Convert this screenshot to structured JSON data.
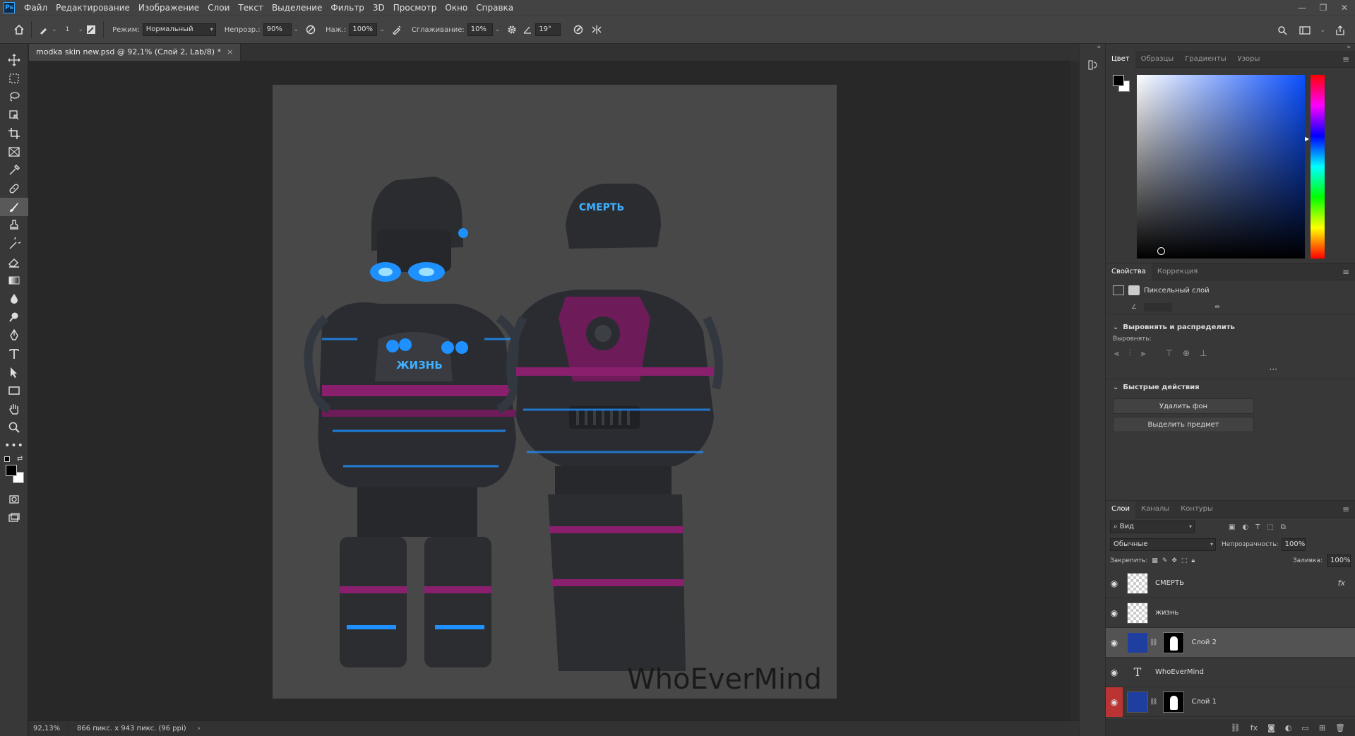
{
  "menubar": {
    "logo": "Ps",
    "items": [
      "Файл",
      "Редактирование",
      "Изображение",
      "Слои",
      "Текст",
      "Выделение",
      "Фильтр",
      "3D",
      "Просмотр",
      "Окно",
      "Справка"
    ]
  },
  "options": {
    "brush_size": "1",
    "mode_label": "Режим:",
    "mode_value": "Нормальный",
    "opacity_label": "Непрозр.:",
    "opacity_value": "90%",
    "pressure_label": "Наж.:",
    "pressure_value": "100%",
    "smoothing_label": "Сглаживание:",
    "smoothing_value": "10%",
    "angle_value": "19°"
  },
  "document": {
    "tab_title": "modka skin new.psd @ 92,1% (Слой 2, Lab/8) *",
    "canvas_text_back": "СМЕРТЬ",
    "canvas_text_front": "ЖИЗНЬ",
    "watermark": "WhoEverMind"
  },
  "status": {
    "zoom": "92,13%",
    "dimensions": "866 пикс. x 943 пикс. (96 ppi)"
  },
  "color_panel": {
    "tabs": [
      "Цвет",
      "Образцы",
      "Градиенты",
      "Узоры"
    ]
  },
  "props_panel": {
    "tabs": [
      "Свойства",
      "Коррекция"
    ],
    "layer_type": "Пиксельный слой",
    "align_section": "Выровнять и распределить",
    "align_label": "Выровнять:",
    "quick_section": "Быстрые действия",
    "remove_bg": "Удалить фон",
    "select_subject": "Выделить предмет"
  },
  "layers_panel": {
    "tabs": [
      "Слои",
      "Каналы",
      "Контуры"
    ],
    "filter_label": "Вид",
    "blend_mode": "Обычные",
    "opacity_label": "Непрозрачность:",
    "opacity_value": "100%",
    "lock_label": "Закрепить:",
    "fill_label": "Заливка:",
    "fill_value": "100%",
    "layers": [
      {
        "name": "СМЕРТЬ"
      },
      {
        "name": "жизнь"
      },
      {
        "name": "Слой 2"
      },
      {
        "name": "WhoEverMind"
      },
      {
        "name": "Слой 1"
      }
    ],
    "fx_label": "fx"
  },
  "colors": {
    "accent_blue": "#1e90ff",
    "magenta": "#8a1f6e"
  }
}
